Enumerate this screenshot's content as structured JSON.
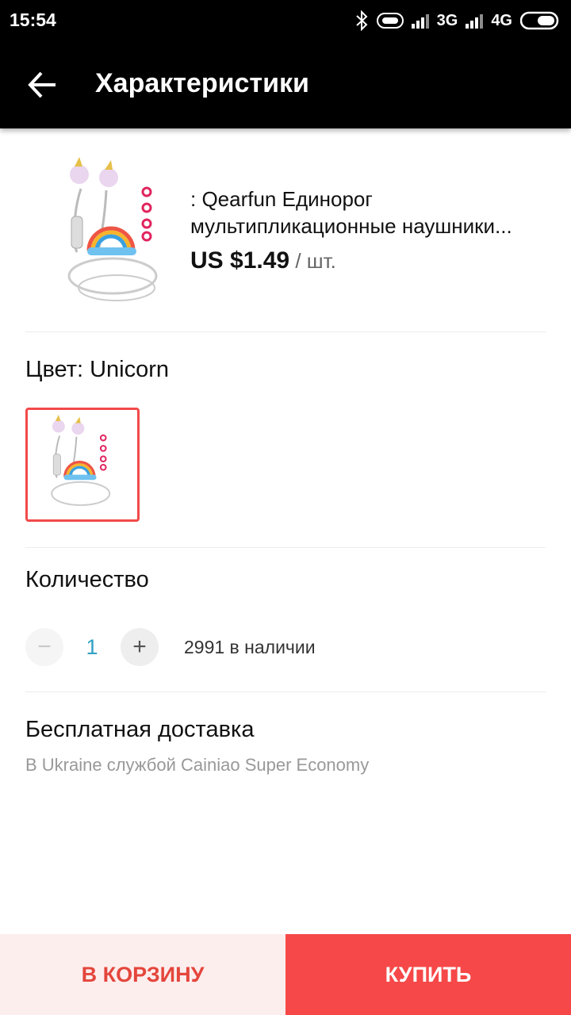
{
  "status_bar": {
    "time": "15:54",
    "net1": "3G",
    "net2": "4G"
  },
  "toolbar": {
    "title": "Характеристики"
  },
  "product": {
    "name_line1": ": Qearfun Единорог",
    "name_line2": "мультипликационные наушники...",
    "price": "US $1.49",
    "unit": " / шт."
  },
  "color": {
    "label": "Цвет: Unicorn"
  },
  "quantity": {
    "label": "Количество",
    "minus": "−",
    "value": "1",
    "plus": "+",
    "stock": "2991 в наличии"
  },
  "shipping": {
    "title": "Бесплатная доставка",
    "subtitle": "В Ukraine службой Cainiao Super Economy"
  },
  "actions": {
    "cart": "В КОРЗИНУ",
    "buy": "КУПИТЬ"
  },
  "colors": {
    "accent": "#f64848",
    "cart_bg": "#fdeeee",
    "qty_value": "#2fa0c4"
  }
}
